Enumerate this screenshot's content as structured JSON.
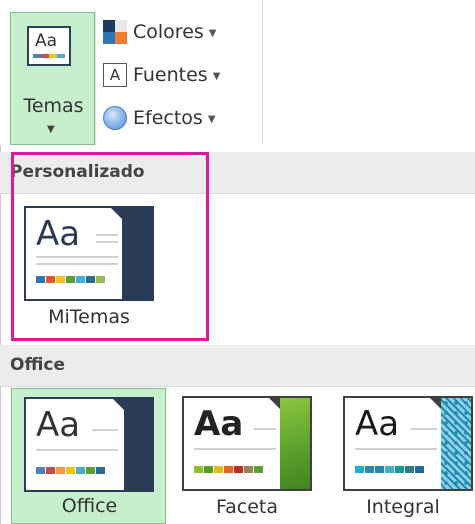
{
  "ribbon": {
    "temas_label": "Temas",
    "colores_label": "Colores",
    "fuentes_label": "Fuentes",
    "fuentes_icon_letter": "A",
    "efectos_label": "Efectos",
    "thumb_text": "Aa"
  },
  "gallery": {
    "personalizado_header": "Personalizado",
    "office_header": "Office",
    "custom_themes": [
      {
        "name": "MiTemas",
        "thumb_text": "Aa"
      }
    ],
    "office_themes": [
      {
        "name": "Office",
        "thumb_text": "Aa",
        "selected": true
      },
      {
        "name": "Faceta",
        "thumb_text": "Aa"
      },
      {
        "name": "Integral",
        "thumb_text": "Aa"
      }
    ]
  },
  "colors": {
    "selected_bg": "#c6efce",
    "highlight_border": "#e0199b",
    "section_header_bg": "#ececec",
    "faceta_green": "#5aa02c",
    "integral_teal": "#1f8ab0"
  },
  "icons": {
    "dropdown": "caret-down-icon",
    "colores": "color-palette-icon",
    "fuentes": "font-icon",
    "efectos": "effects-icon"
  }
}
